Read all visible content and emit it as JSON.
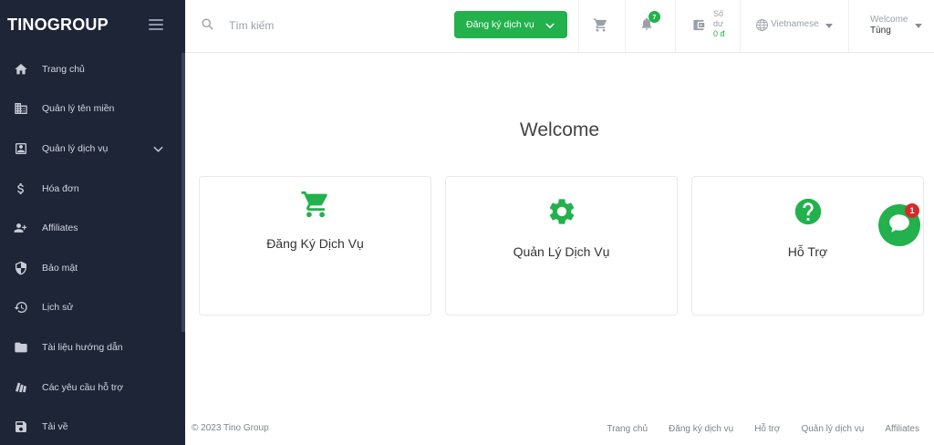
{
  "sidebar": {
    "logo": "TINOGROUP",
    "items": [
      {
        "label": "Trang chủ",
        "icon": "home-icon"
      },
      {
        "label": "Quản lý tên miền",
        "icon": "domain-icon"
      },
      {
        "label": "Quản lý dịch vụ",
        "icon": "service-icon"
      },
      {
        "label": "Hóa đơn",
        "icon": "dollar-icon"
      },
      {
        "label": "Affiliates",
        "icon": "affiliate-icon"
      },
      {
        "label": "Bảo mật",
        "icon": "shield-icon"
      },
      {
        "label": "Lịch sử",
        "icon": "history-icon"
      },
      {
        "label": "Tài liệu hướng dẫn",
        "icon": "folder-icon"
      },
      {
        "label": "Các yêu cầu hỗ trợ",
        "icon": "ticket-icon"
      },
      {
        "label": "Tải về",
        "icon": "download-icon"
      }
    ]
  },
  "topbar": {
    "search_placeholder": "Tìm kiếm",
    "register_button": "Đăng ký dịch vụ",
    "notification_count": "7",
    "balance_label_1": "Số",
    "balance_label_2": "dư",
    "balance_amount": "0 đ",
    "language": "Vietnamese",
    "welcome_label": "Welcome",
    "user_name": "Tùng"
  },
  "main": {
    "title": "Welcome",
    "cards": [
      {
        "label": "Đăng Ký Dịch Vụ",
        "icon": "cart-icon"
      },
      {
        "label": "Quản Lý Dịch Vụ",
        "icon": "gear-icon"
      },
      {
        "label": "Hỗ Trợ",
        "icon": "help-icon"
      }
    ]
  },
  "chat": {
    "badge": "1"
  },
  "footer": {
    "copyright": "© 2023 Tino Group",
    "links": [
      "Trang chủ",
      "Đăng ký dịch vụ",
      "Hỗ trợ",
      "Quản lý dịch vụ",
      "Affiliates"
    ]
  },
  "colors": {
    "sidebar_bg": "#1e2537",
    "accent": "#22b14c",
    "badge_red": "#d62a2a"
  }
}
